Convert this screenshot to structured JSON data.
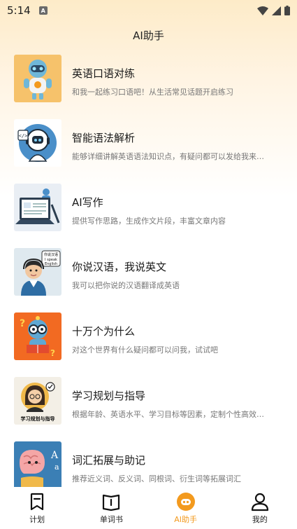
{
  "status_bar": {
    "time": "5:14",
    "notification_glyph": "A"
  },
  "header": {
    "title": "AI助手"
  },
  "colors": {
    "accent": "#f39a1e",
    "header_bg": "#fdebc8"
  },
  "items": [
    {
      "title": "英语口语对练",
      "desc": "和我一起练习口语吧！从生活常见话题开启练习",
      "icon": "robot-icon"
    },
    {
      "title": "智能语法解析",
      "desc": "能够详细讲解英语语法知识点，有疑问都可以发给我来…",
      "icon": "headset-robot-icon"
    },
    {
      "title": "AI写作",
      "desc": "提供写作思路，生成作文片段，丰富文章内容",
      "icon": "laptop-writing-icon"
    },
    {
      "title": "你说汉语，我说英文",
      "desc": "我可以把你说的汉语翻译成英语",
      "icon": "translator-man-icon",
      "thumb_text": [
        "你说汉语",
        "I speak",
        "English"
      ]
    },
    {
      "title": "十万个为什么",
      "desc": "对这个世界有什么疑问都可以问我，试试吧",
      "icon": "question-robot-icon"
    },
    {
      "title": "学习规划与指导",
      "desc": "根据年龄、英语水平、学习目标等因素，定制个性高效…",
      "icon": "teacher-icon",
      "thumb_text": [
        "学习规划与指导"
      ]
    },
    {
      "title": "词汇拓展与助记",
      "desc": "推荐近义词、反义词、同根词、衍生词等拓展词汇",
      "icon": "brain-book-icon",
      "thumb_text": [
        "A",
        "a"
      ]
    }
  ],
  "tabs": [
    {
      "label": "计划",
      "icon": "bookmark-icon",
      "active": false
    },
    {
      "label": "单词书",
      "icon": "book-icon",
      "active": false
    },
    {
      "label": "AI助手",
      "icon": "ai-bot-icon",
      "active": true
    },
    {
      "label": "我的",
      "icon": "user-icon",
      "active": false
    }
  ]
}
